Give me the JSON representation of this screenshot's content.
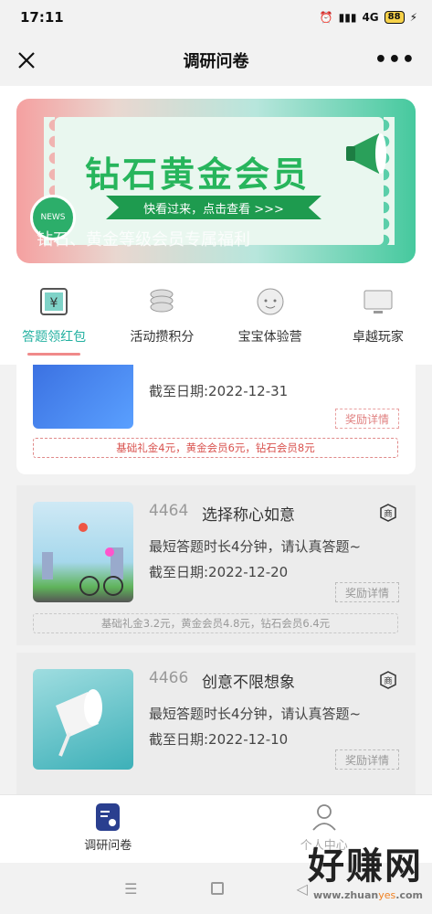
{
  "status": {
    "time": "17:11",
    "network": "4G",
    "battery": "88"
  },
  "nav": {
    "title": "调研问卷"
  },
  "banner": {
    "title": "钻石黄金会员",
    "ribbon": "快看过来，点击查看 >>>",
    "subtitle": "钻石、黄金等级会员专属福利",
    "news": "NEWS"
  },
  "tabs": [
    {
      "label": "答题领红包",
      "active": true
    },
    {
      "label": "活动攒积分"
    },
    {
      "label": "宝宝体验营"
    },
    {
      "label": "卓越玩家"
    }
  ],
  "cards": [
    {
      "date": "截至日期:2022-12-31",
      "reward": "奖励详情",
      "bonus": "基础礼金4元，黄金会员6元，钻石会员8元"
    },
    {
      "id": "4464",
      "name": "选择称心如意",
      "desc": "最短答题时长4分钟，请认真答题~",
      "date": "截至日期:2022-12-20",
      "reward": "奖励详情",
      "bonus": "基础礼金3.2元，黄金会员4.8元，钻石会员6.4元"
    },
    {
      "id": "4466",
      "name": "创意不限想象",
      "desc": "最短答题时长4分钟，请认真答题~",
      "date": "截至日期:2022-12-10",
      "reward": "奖励详情"
    }
  ],
  "bottom_nav": [
    {
      "label": "调研问卷"
    },
    {
      "label": "个人中心"
    }
  ],
  "watermark": {
    "big": "好赚网",
    "small_a": "www.zhuan",
    "small_b": "yes",
    "small_c": ".com"
  }
}
